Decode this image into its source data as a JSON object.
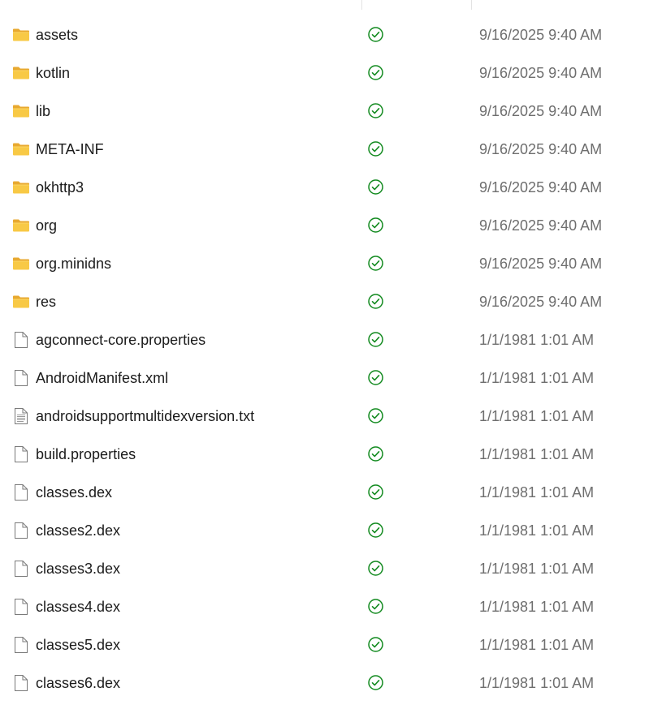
{
  "files": [
    {
      "name": "assets",
      "icon": "folder-icon",
      "status_icon": "synced-check-icon",
      "modified": "9/16/2025 9:40 AM"
    },
    {
      "name": "kotlin",
      "icon": "folder-icon",
      "status_icon": "synced-check-icon",
      "modified": "9/16/2025 9:40 AM"
    },
    {
      "name": "lib",
      "icon": "folder-icon",
      "status_icon": "synced-check-icon",
      "modified": "9/16/2025 9:40 AM"
    },
    {
      "name": "META-INF",
      "icon": "folder-icon",
      "status_icon": "synced-check-icon",
      "modified": "9/16/2025 9:40 AM"
    },
    {
      "name": "okhttp3",
      "icon": "folder-icon",
      "status_icon": "synced-check-icon",
      "modified": "9/16/2025 9:40 AM"
    },
    {
      "name": "org",
      "icon": "folder-icon",
      "status_icon": "synced-check-icon",
      "modified": "9/16/2025 9:40 AM"
    },
    {
      "name": "org.minidns",
      "icon": "folder-icon",
      "status_icon": "synced-check-icon",
      "modified": "9/16/2025 9:40 AM"
    },
    {
      "name": "res",
      "icon": "folder-icon",
      "status_icon": "synced-check-icon",
      "modified": "9/16/2025 9:40 AM"
    },
    {
      "name": "agconnect-core.properties",
      "icon": "file-icon",
      "status_icon": "synced-check-icon",
      "modified": "1/1/1981 1:01 AM"
    },
    {
      "name": "AndroidManifest.xml",
      "icon": "file-icon",
      "status_icon": "synced-check-icon",
      "modified": "1/1/1981 1:01 AM"
    },
    {
      "name": "androidsupportmultidexversion.txt",
      "icon": "text-file-icon",
      "status_icon": "synced-check-icon",
      "modified": "1/1/1981 1:01 AM"
    },
    {
      "name": "build.properties",
      "icon": "file-icon",
      "status_icon": "synced-check-icon",
      "modified": "1/1/1981 1:01 AM"
    },
    {
      "name": "classes.dex",
      "icon": "file-icon",
      "status_icon": "synced-check-icon",
      "modified": "1/1/1981 1:01 AM"
    },
    {
      "name": "classes2.dex",
      "icon": "file-icon",
      "status_icon": "synced-check-icon",
      "modified": "1/1/1981 1:01 AM"
    },
    {
      "name": "classes3.dex",
      "icon": "file-icon",
      "status_icon": "synced-check-icon",
      "modified": "1/1/1981 1:01 AM"
    },
    {
      "name": "classes4.dex",
      "icon": "file-icon",
      "status_icon": "synced-check-icon",
      "modified": "1/1/1981 1:01 AM"
    },
    {
      "name": "classes5.dex",
      "icon": "file-icon",
      "status_icon": "synced-check-icon",
      "modified": "1/1/1981 1:01 AM"
    },
    {
      "name": "classes6.dex",
      "icon": "file-icon",
      "status_icon": "synced-check-icon",
      "modified": "1/1/1981 1:01 AM"
    }
  ],
  "colors": {
    "status_green": "#128a1f",
    "folder_yellow": "#f8c945",
    "text": "#1b1b1b",
    "muted_text": "#6e6e6e"
  }
}
